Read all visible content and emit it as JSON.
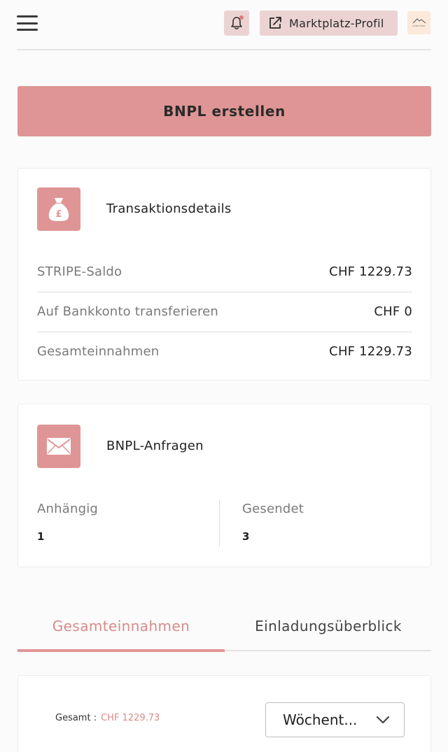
{
  "header": {
    "profile_label": "Marktplatz-Profil",
    "avatar_text": "GENALPINE"
  },
  "create_button_label": "BNPL erstellen",
  "transactions": {
    "title": "Transaktionsdetails",
    "rows": [
      {
        "label": "STRIPE-Saldo",
        "value": "CHF 1229.73"
      },
      {
        "label": "Auf Bankkonto transferieren",
        "value": "CHF 0"
      },
      {
        "label": "Gesamteinnahmen",
        "value": "CHF 1229.73"
      }
    ]
  },
  "requests": {
    "title": "BNPL-Anfragen",
    "pending_label": "Anhängig",
    "pending_value": "1",
    "sent_label": "Gesendet",
    "sent_value": "3"
  },
  "tabs": [
    {
      "label": "Gesamteinnahmen",
      "active": true
    },
    {
      "label": "Einladungsüberblick",
      "active": false
    }
  ],
  "summary": {
    "total_label": "Gesamt :",
    "total_value": "CHF 1229.73",
    "period_selected": "Wöchent..."
  },
  "colors": {
    "accent": "#df9595",
    "accent_text": "#d88b8b",
    "button_bg": "#ecd3d3"
  },
  "icons": {
    "menu": "hamburger-menu-icon",
    "bell": "bell-icon",
    "external": "external-link-icon",
    "money_bag": "money-bag-icon",
    "mail": "envelope-icon",
    "chevron": "chevron-down-icon"
  }
}
